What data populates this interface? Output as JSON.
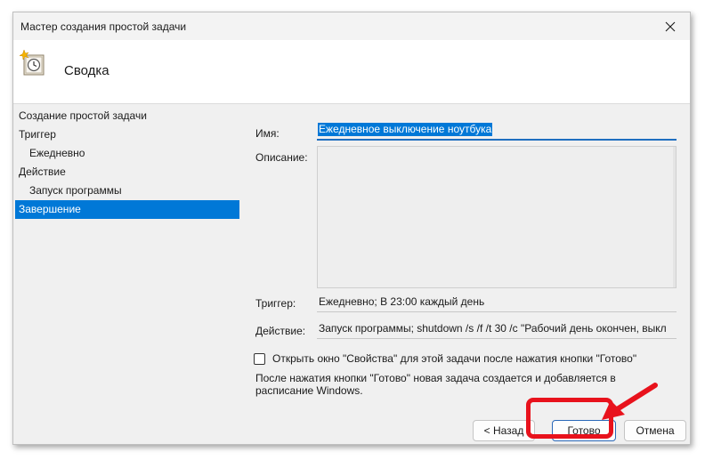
{
  "window": {
    "title": "Мастер создания простой задачи"
  },
  "header": {
    "title": "Сводка",
    "icon": "clock-task-icon"
  },
  "nav": {
    "items": [
      {
        "label": "Создание простой задачи",
        "level": 0,
        "active": false
      },
      {
        "label": "Триггер",
        "level": 0,
        "active": false
      },
      {
        "label": "Ежедневно",
        "level": 1,
        "active": false
      },
      {
        "label": "Действие",
        "level": 0,
        "active": false
      },
      {
        "label": "Запуск программы",
        "level": 1,
        "active": false
      },
      {
        "label": "Завершение",
        "level": 0,
        "active": true
      }
    ]
  },
  "form": {
    "name_label": "Имя:",
    "name_value": "Ежедневное выключение ноутбука",
    "description_label": "Описание:",
    "description_value": "",
    "trigger_label": "Триггер:",
    "trigger_value": "Ежедневно; В 23:00 каждый день",
    "action_label": "Действие:",
    "action_value": "Запуск программы; shutdown /s /f /t 30 /c \"Рабочий день окончен, выкл"
  },
  "checkbox": {
    "label": "Открыть окно \"Свойства\" для этой задачи после нажатия кнопки \"Готово\"",
    "checked": false
  },
  "info_text": "После нажатия кнопки \"Готово\" новая задача создается и добавляется в расписание Windows.",
  "buttons": {
    "back": "< Назад",
    "finish": "Готово",
    "cancel": "Отмена"
  },
  "colors": {
    "accent": "#0078d7",
    "annotation": "#e8121c"
  }
}
